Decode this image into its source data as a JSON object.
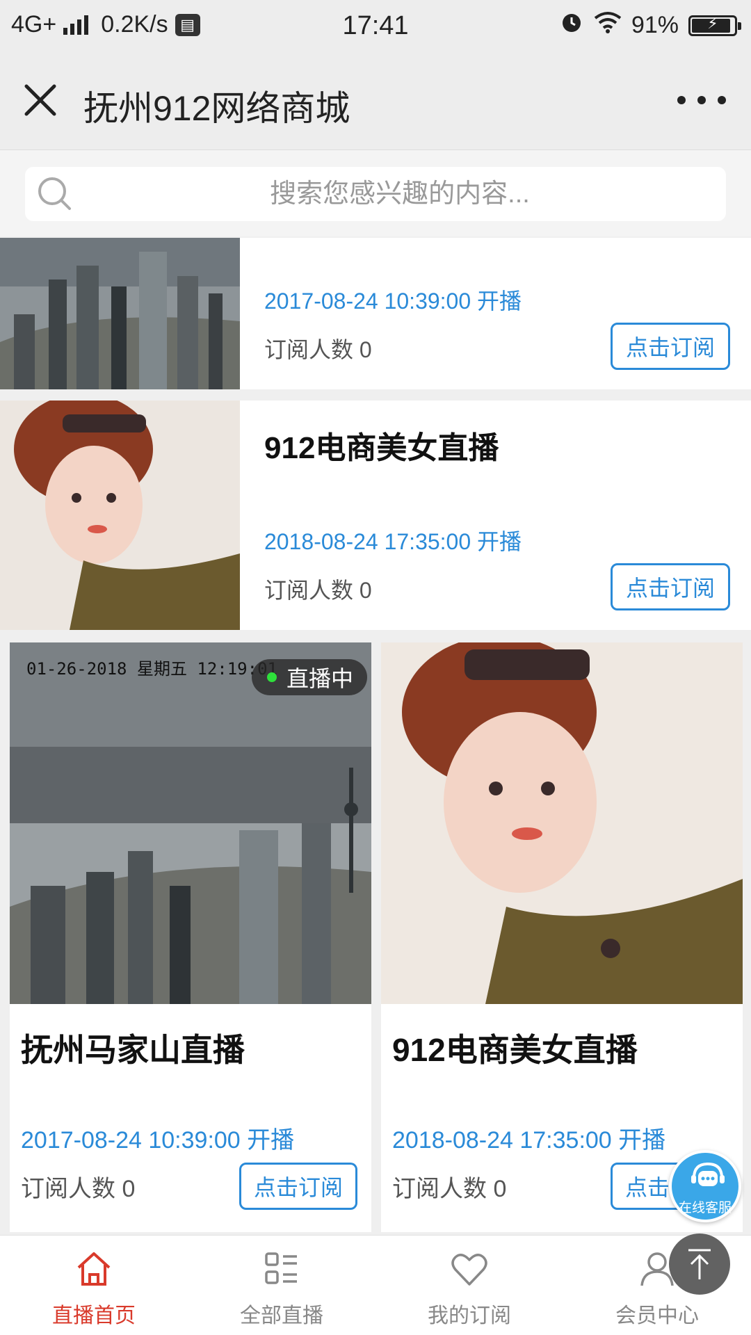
{
  "status_bar": {
    "network": "4G+",
    "speed": "0.2K/s",
    "time": "17:41",
    "battery": "91%",
    "battery_level": 0.91
  },
  "navbar": {
    "title": "抚州912网络商城",
    "close_icon": "close-icon",
    "more_icon": "more-icon"
  },
  "search": {
    "placeholder": "搜索您感兴趣的内容..."
  },
  "list": [
    {
      "title": "",
      "time": "2017-08-24 10:39:00 开播",
      "subscribers": "订阅人数 0",
      "button": "点击订阅",
      "thumb": "city-skyline"
    },
    {
      "title": "912电商美女直播",
      "time": "2018-08-24 17:35:00 开播",
      "subscribers": "订阅人数 0",
      "button": "点击订阅",
      "thumb": "portrait"
    }
  ],
  "grid": [
    {
      "title": "抚州马家山直播",
      "time": "2017-08-24 10:39:00 开播",
      "subscribers": "订阅人数 0",
      "button": "点击订阅",
      "live_badge": "直播中",
      "timestamp": "01-26-2018 星期五 12:19:01",
      "thumb": "city-skyline"
    },
    {
      "title": "912电商美女直播",
      "time": "2018-08-24 17:35:00 开播",
      "subscribers": "订阅人数 0",
      "button": "点击订阅",
      "thumb": "portrait"
    }
  ],
  "floating": {
    "service_label": "在线客服",
    "back_to_top_icon": "arrow-up-icon"
  },
  "tabs": [
    {
      "label": "直播首页",
      "icon": "home-icon",
      "active": true
    },
    {
      "label": "全部直播",
      "icon": "grid-list-icon",
      "active": false
    },
    {
      "label": "我的订阅",
      "icon": "heart-icon",
      "active": false
    },
    {
      "label": "会员中心",
      "icon": "user-icon",
      "active": false
    }
  ],
  "colors": {
    "accent_blue": "#2a8ad8",
    "active_red": "#d93a2b",
    "live_green": "#2ee03b"
  }
}
